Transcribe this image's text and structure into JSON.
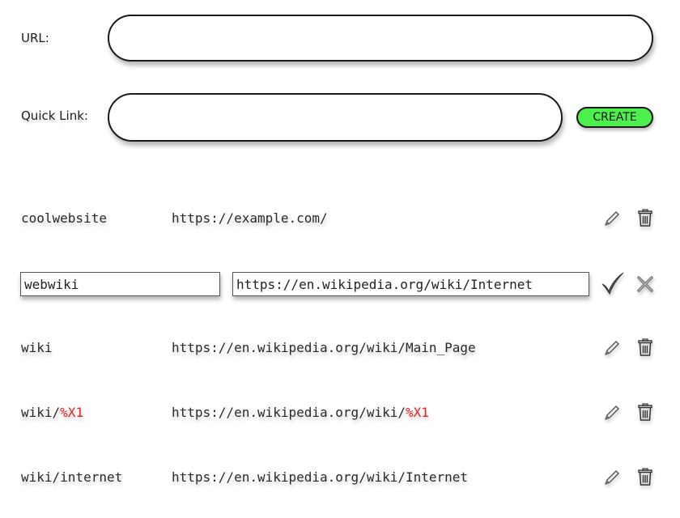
{
  "form": {
    "url_label": "URL:",
    "url_value": "",
    "quicklink_label": "Quick Link:",
    "quicklink_value": "",
    "create_label": "CREATE"
  },
  "links": [
    {
      "name": "coolwebsite",
      "url": "https://example.com/"
    },
    {
      "name": "webwiki",
      "url": "https://en.wikipedia.org/wiki/Internet",
      "editing": true
    },
    {
      "name": "wiki",
      "url": "https://en.wikipedia.org/wiki/Main_Page"
    },
    {
      "name_prefix": "wiki/",
      "name_var": "%X1",
      "url_prefix": "https://en.wikipedia.org/wiki/",
      "url_var": "%X1"
    },
    {
      "name": "wiki/internet",
      "url": "https://en.wikipedia.org/wiki/Internet"
    }
  ],
  "icons": {
    "edit": "pencil-icon",
    "delete": "trash-icon",
    "confirm": "checkmark-icon",
    "cancel": "x-icon"
  },
  "colors": {
    "create_button": "#4cf04c",
    "variable_highlight": "#ee1c1c"
  }
}
